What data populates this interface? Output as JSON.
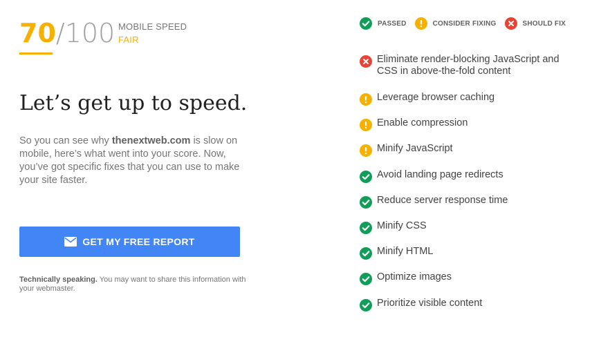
{
  "score": {
    "value": "70",
    "total": "/100",
    "label": "MOBILE SPEED",
    "rating": "FAIR"
  },
  "headline": "Let’s get up to speed.",
  "description": {
    "prefix": "So you can see why ",
    "domain": "thenextweb.com",
    "suffix": " is slow on mobile, here’s what went into your score. Now, you’ve got specific fixes that you can use to make your site faster."
  },
  "report_button": {
    "icon": "mail-icon",
    "label": "GET MY FREE REPORT"
  },
  "footnote": {
    "bold": "Technically speaking.",
    "text": " You may want to share this information with your webmaster."
  },
  "legend": {
    "passed": "PASSED",
    "consider": "CONSIDER FIXING",
    "should": "SHOULD FIX"
  },
  "rules": [
    {
      "status": "should-fix",
      "label": "Eliminate render-blocking JavaScript and CSS in above-the-fold content"
    },
    {
      "status": "consider-fixing",
      "label": "Leverage browser caching"
    },
    {
      "status": "consider-fixing",
      "label": "Enable compression"
    },
    {
      "status": "consider-fixing",
      "label": "Minify JavaScript"
    },
    {
      "status": "passed",
      "label": "Avoid landing page redirects"
    },
    {
      "status": "passed",
      "label": "Reduce server response time"
    },
    {
      "status": "passed",
      "label": "Minify CSS"
    },
    {
      "status": "passed",
      "label": "Minify HTML"
    },
    {
      "status": "passed",
      "label": "Optimize images"
    },
    {
      "status": "passed",
      "label": "Prioritize visible content"
    }
  ],
  "colors": {
    "accent": "#f6b100",
    "button": "#4285f4",
    "passed": "#0f9d58",
    "consider": "#f6b100",
    "should": "#ea4335"
  },
  "icons": {
    "passed": "check-circle-icon",
    "consider": "exclamation-circle-icon",
    "should": "x-circle-icon"
  }
}
